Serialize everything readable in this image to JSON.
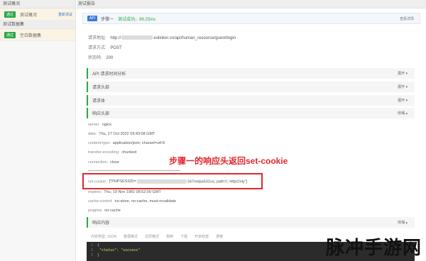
{
  "left": {
    "summary_title": "测试概况",
    "summary_row": {
      "badge": "通过",
      "label": "测试概况",
      "link": "重新测试"
    },
    "data_title": "测试数据集",
    "data_row": {
      "badge": "通过",
      "label": "空白数据集"
    }
  },
  "report": {
    "title": "测试报告",
    "step": {
      "badge": "API",
      "step_label": "步骤一",
      "status": "测试成功，89.25ms",
      "detail": "查看详情"
    },
    "url_label": "请求地址:",
    "url_prefix": "http://",
    "url_suffix": "eolinker.cn/api/human_resource/guest/login",
    "method_label": "请求方式:",
    "method": "POST",
    "status_label": "状态码:",
    "status_code": "200"
  },
  "sections": {
    "timing": {
      "label": "API 请求时间分析",
      "toggle": "展开 ▾"
    },
    "req_headers": {
      "label": "请求头部",
      "toggle": "展开 ▾"
    },
    "req_body": {
      "label": "请求体",
      "toggle": "展开 ▾"
    },
    "resp_headers": {
      "label": "响应头部",
      "toggle": "收缩 ▴"
    },
    "resp_body": {
      "label": "响应内容",
      "toggle": "收缩 ▴"
    }
  },
  "headers": [
    {
      "k": "server:",
      "v": "nginx"
    },
    {
      "k": "date:",
      "v": "Thu, 27 Oct 2022 09:43:08 GMT"
    },
    {
      "k": "content-type:",
      "v": "application/json; charset=utf-8"
    },
    {
      "k": "transfer-encoding:",
      "v": "chunked"
    },
    {
      "k": "connection:",
      "v": "close"
    },
    {
      "k": "set-cookie:",
      "v": "[\"PHPSESSID=",
      "v2": "347mdpa532va; path=/; HttpOnly\"]"
    },
    {
      "k": "expires:",
      "v": "Thu, 19 Nov 1981 08:52:00 GMT"
    },
    {
      "k": "cache-control:",
      "v": "no-store, no-cache, must-revalidate"
    },
    {
      "k": "pragma:",
      "v": "no-cache"
    }
  ],
  "annotation": "步骤一的响应头返回set-cookie",
  "toolbar": [
    "内容类型: JSON",
    "整理格式",
    "还原格式",
    "复制",
    "下载",
    "开启标签",
    "搜索"
  ],
  "code_lines": [
    {
      "n": "1",
      "t": "{"
    },
    {
      "n": "2",
      "t": "    \"status\": \"success\""
    },
    {
      "n": "3",
      "t": "}"
    }
  ],
  "watermark": {
    "text": "脉冲手游网",
    "badge": ""
  },
  "colors": {
    "pass": "#2aa84a",
    "accent": "#3a7bd5",
    "annotation": "#e0282f"
  }
}
